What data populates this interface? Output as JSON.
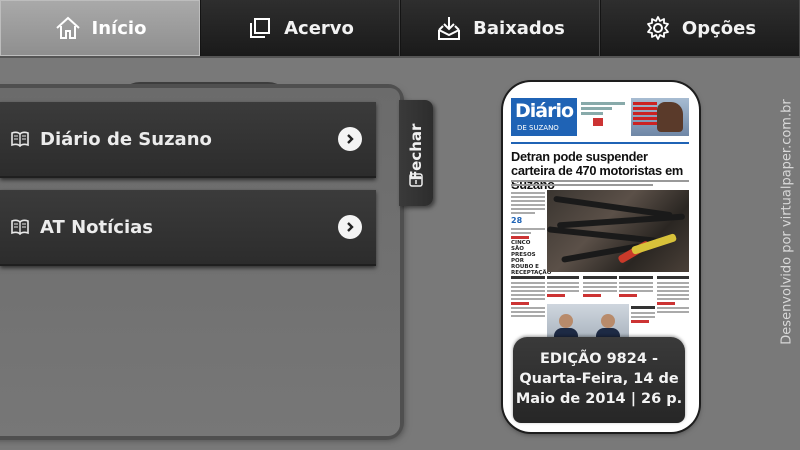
{
  "tabs": [
    {
      "label": "Início",
      "icon": "home-icon",
      "active": true
    },
    {
      "label": "Acervo",
      "icon": "copy-icon",
      "active": false
    },
    {
      "label": "Baixados",
      "icon": "download-icon",
      "active": false
    },
    {
      "label": "Opções",
      "icon": "gear-icon",
      "active": false
    }
  ],
  "drawer": {
    "items": [
      {
        "label": "Diário de Suzano",
        "icon": "book-icon"
      },
      {
        "label": "AT Notícias",
        "icon": "book-icon"
      }
    ],
    "close_label": "Fechar"
  },
  "cover": {
    "logo_main": "Diário",
    "logo_sub": "DE SUZANO",
    "headline": "Detran pode suspender carteira de 470 motoristas em Suzano",
    "number": "28",
    "side_head": "CINCO SÃO PRESOS POR ROUBO E RECEPTAÇÃO"
  },
  "edition": {
    "line1": "EDIÇÃO 9824 -",
    "line2": "Quarta-Feira, 14 de",
    "line3": "Maio de 2014 | 26 p."
  },
  "credit": "Desenvolvido por virtualpaper.com.br",
  "colors": {
    "background": "#797979",
    "tab_active": "#9a9a9a",
    "tab_bar": "#222222",
    "newspaper_blue": "#1f63b5"
  }
}
